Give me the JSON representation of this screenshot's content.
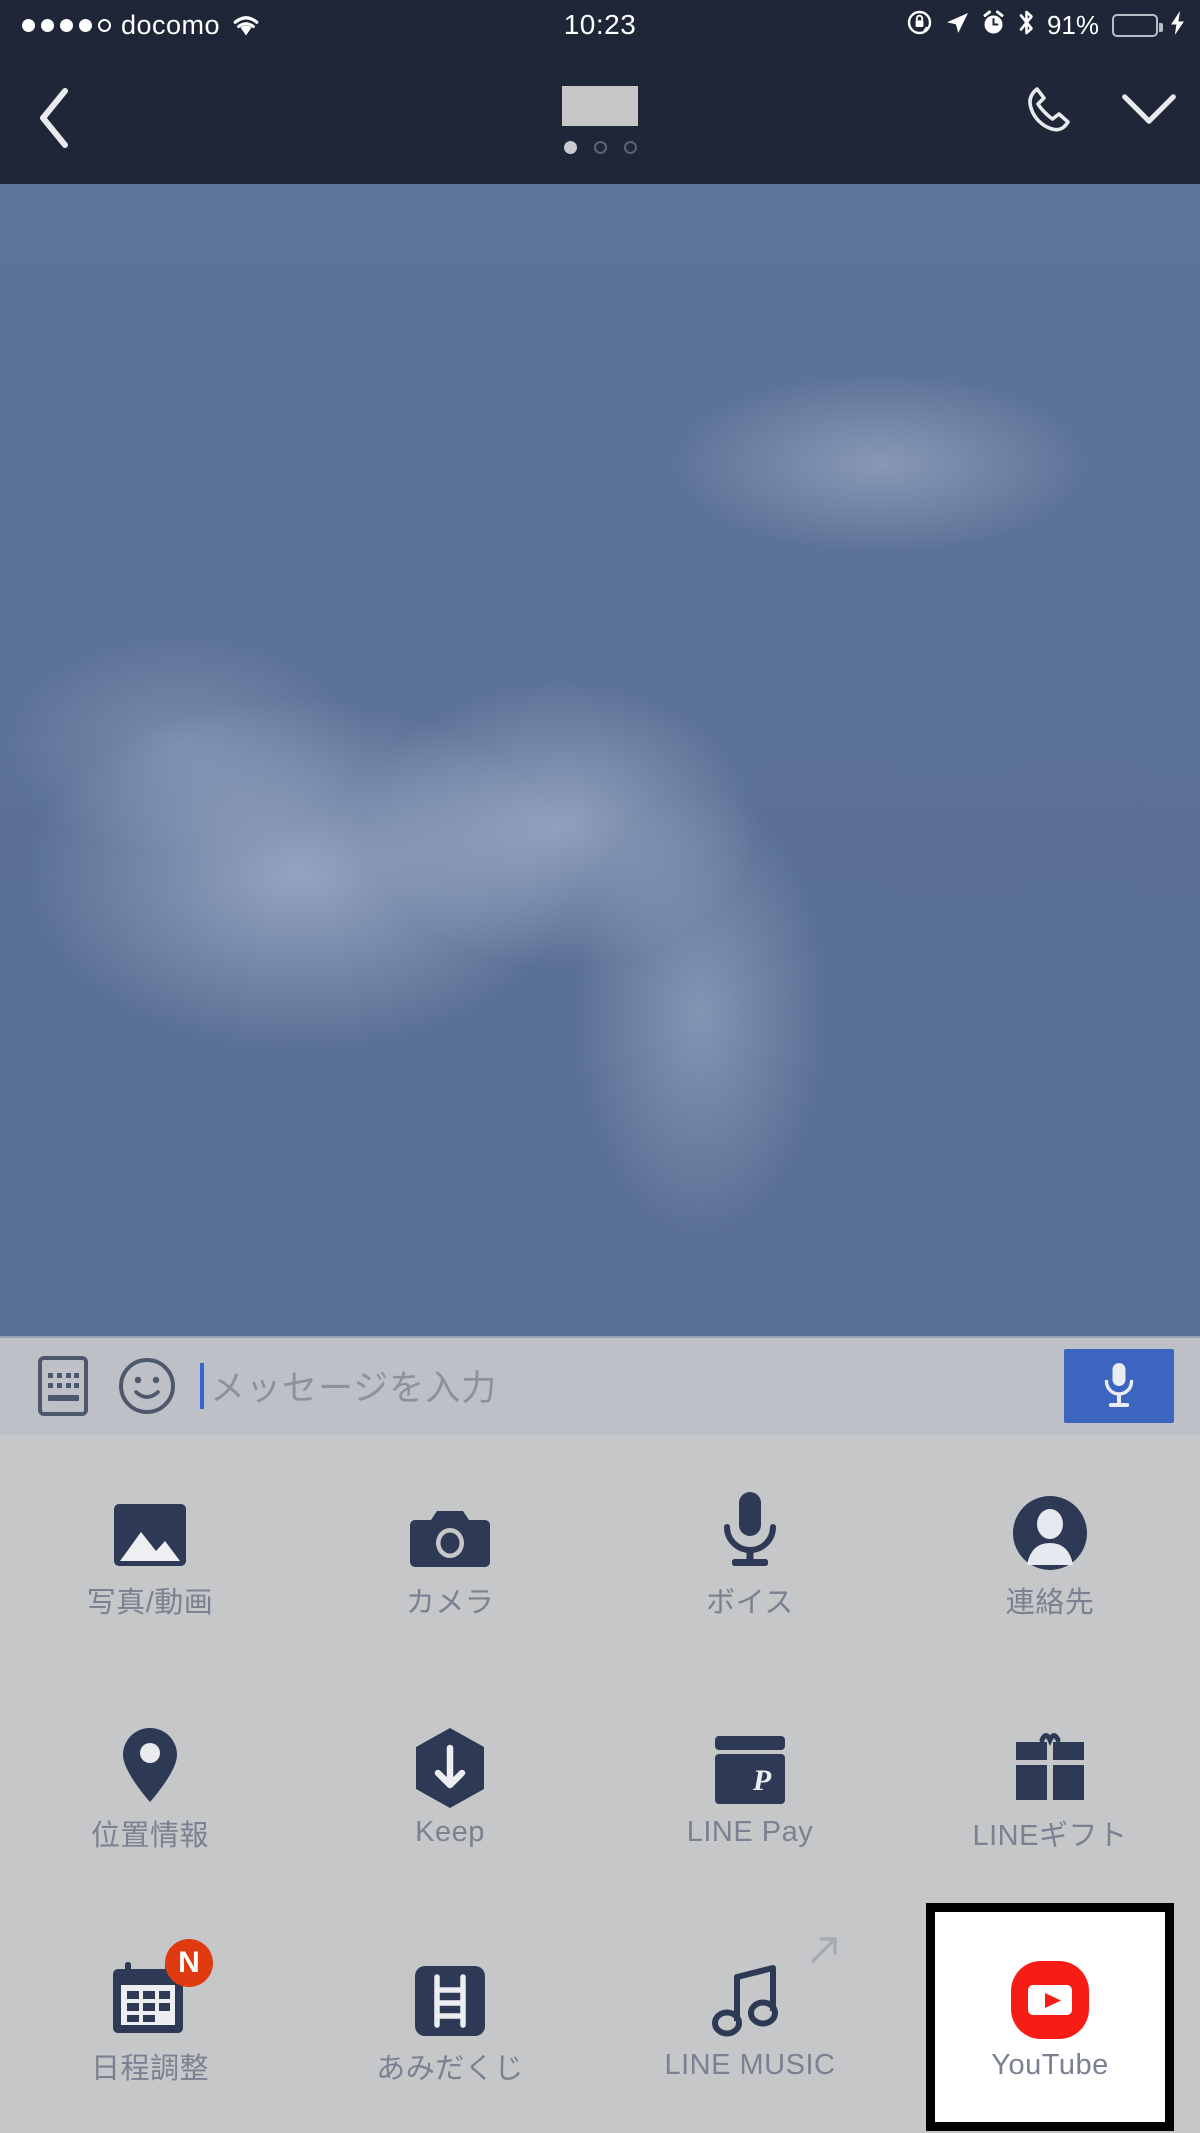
{
  "status_bar": {
    "carrier": "docomo",
    "signal_dots_filled": 4,
    "signal_dots_total": 5,
    "wifi_icon": "wifi-icon",
    "time": "10:23",
    "icons": [
      "rotation-lock-icon",
      "location-arrow-icon",
      "alarm-clock-icon",
      "bluetooth-icon"
    ],
    "battery_percent": "91%",
    "battery_color": "#3ec53e",
    "charging_icon": "lightning-bolt-icon"
  },
  "nav_bar": {
    "back_icon": "chevron-left-icon",
    "title_redacted": true,
    "page_dots": {
      "total": 3,
      "active_index": 0
    },
    "call_icon": "phone-handset-icon",
    "collapse_icon": "chevron-down-icon",
    "background_color": "#1e2637"
  },
  "photo_area": {
    "description_icon": "sky-background-image",
    "sky_color": "#5c7197"
  },
  "input_bar": {
    "keyboard_icon": "keyboard-icon",
    "emoji_icon": "smiley-face-icon",
    "placeholder": "メッセージを入力",
    "value": "",
    "caret_color": "#3265d4",
    "mic_button_icon": "microphone-icon",
    "mic_button_color": "#3b65bf",
    "background_color": "#bdc0c6"
  },
  "app_grid": {
    "background_color": "#c5c7c9",
    "icon_color": "#2e3a55",
    "label_color": "#7b8190",
    "items": [
      {
        "label": "写真/動画",
        "icon": "photo-video-icon",
        "highlighted": false
      },
      {
        "label": "カメラ",
        "icon": "camera-icon",
        "highlighted": false
      },
      {
        "label": "ボイス",
        "icon": "voice-microphone-icon",
        "highlighted": false
      },
      {
        "label": "連絡先",
        "icon": "contact-person-icon",
        "highlighted": false
      },
      {
        "label": "位置情報",
        "icon": "location-pin-icon",
        "highlighted": false
      },
      {
        "label": "Keep",
        "icon": "keep-hexagon-arrow-icon",
        "highlighted": false
      },
      {
        "label": "LINE Pay",
        "icon": "line-pay-card-icon",
        "highlighted": false
      },
      {
        "label": "LINEギフト",
        "icon": "gift-box-icon",
        "highlighted": false
      },
      {
        "label": "日程調整",
        "icon": "calendar-icon",
        "badge": "N",
        "badge_color": "#e03a10",
        "highlighted": false
      },
      {
        "label": "あみだくじ",
        "icon": "ladder-lottery-icon",
        "highlighted": false
      },
      {
        "label": "LINE MUSIC",
        "icon": "music-note-icon",
        "external_link_icon": "external-link-arrow-icon",
        "highlighted": false
      },
      {
        "label": "YouTube",
        "icon": "youtube-logo-icon",
        "highlighted": true,
        "highlight_border_color": "#000000",
        "highlight_background": "#ffffff"
      }
    ]
  }
}
